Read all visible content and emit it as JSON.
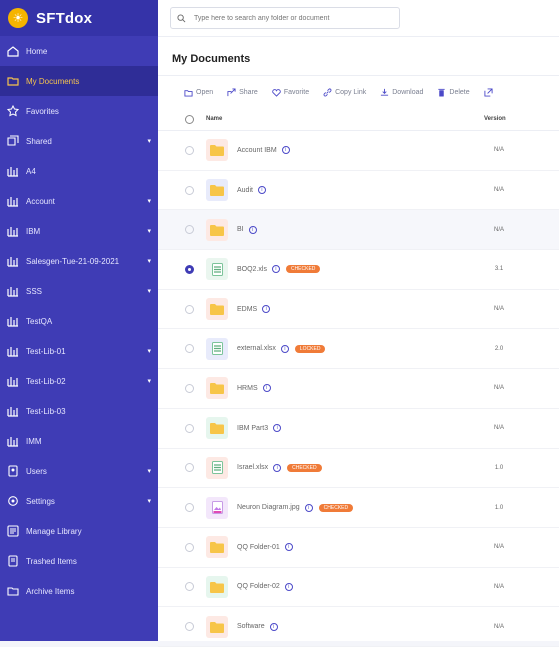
{
  "app": {
    "name": "SFTdox"
  },
  "search": {
    "placeholder": "Type here to search any folder or document"
  },
  "sidebar": {
    "items": [
      {
        "label": "Home",
        "icon": "home-icon",
        "caret": false,
        "active": false
      },
      {
        "label": "My Documents",
        "icon": "documents-icon",
        "caret": false,
        "active": true
      },
      {
        "label": "Favorites",
        "icon": "star-icon",
        "caret": false,
        "active": false
      },
      {
        "label": "Shared",
        "icon": "share-icon",
        "caret": true,
        "active": false
      },
      {
        "label": "A4",
        "icon": "library-icon",
        "caret": false,
        "active": false
      },
      {
        "label": "Account",
        "icon": "library-icon",
        "caret": true,
        "active": false
      },
      {
        "label": "IBM",
        "icon": "library-icon",
        "caret": true,
        "active": false
      },
      {
        "label": "Salesgen-Tue-21-09-2021",
        "icon": "library-icon",
        "caret": true,
        "active": false
      },
      {
        "label": "SSS",
        "icon": "library-icon",
        "caret": true,
        "active": false
      },
      {
        "label": "TestQA",
        "icon": "library-icon",
        "caret": false,
        "active": false
      },
      {
        "label": "Test-Lib-01",
        "icon": "library-icon",
        "caret": true,
        "active": false
      },
      {
        "label": "Test-Lib-02",
        "icon": "library-icon",
        "caret": true,
        "active": false
      },
      {
        "label": "Test-Lib-03",
        "icon": "library-icon",
        "caret": false,
        "active": false
      },
      {
        "label": "IMM",
        "icon": "library-icon",
        "caret": false,
        "active": false
      },
      {
        "label": "Users",
        "icon": "users-icon",
        "caret": true,
        "active": false
      },
      {
        "label": "Settings",
        "icon": "gear-icon",
        "caret": true,
        "active": false
      },
      {
        "label": "Manage Library",
        "icon": "manage-library-icon",
        "caret": false,
        "active": false
      },
      {
        "label": "Trashed Items",
        "icon": "trash-icon",
        "caret": false,
        "active": false
      },
      {
        "label": "Archive Items",
        "icon": "archive-icon",
        "caret": false,
        "active": false
      }
    ]
  },
  "main": {
    "title": "My Documents",
    "toolbar": {
      "open": "Open",
      "share": "Share",
      "favorite": "Favorite",
      "copy_link": "Copy Link",
      "download": "Download",
      "delete": "Delete"
    },
    "table": {
      "headers": {
        "name": "Name",
        "version": "Version"
      },
      "rows": [
        {
          "name": "Account IBM",
          "type": "folder",
          "tint": "red",
          "version": "N/A",
          "checked": false,
          "badge": ""
        },
        {
          "name": "Audit",
          "type": "folder",
          "tint": "blue",
          "version": "N/A",
          "checked": false,
          "badge": ""
        },
        {
          "name": "BI",
          "type": "folder",
          "tint": "red",
          "version": "N/A",
          "checked": false,
          "badge": ""
        },
        {
          "name": "BOQ2.xls",
          "type": "file",
          "tint": "green",
          "version": "3.1",
          "checked": true,
          "badge": "CHECKED"
        },
        {
          "name": "EDMS",
          "type": "folder",
          "tint": "red",
          "version": "N/A",
          "checked": false,
          "badge": ""
        },
        {
          "name": "external.xlsx",
          "type": "file",
          "tint": "blue",
          "version": "2.0",
          "checked": false,
          "badge": "LOCKED"
        },
        {
          "name": "HRMS",
          "type": "folder",
          "tint": "red",
          "version": "N/A",
          "checked": false,
          "badge": ""
        },
        {
          "name": "IBM Part3",
          "type": "folder",
          "tint": "green",
          "version": "N/A",
          "checked": false,
          "badge": ""
        },
        {
          "name": "Israel.xlsx",
          "type": "file",
          "tint": "red",
          "version": "1.0",
          "checked": false,
          "badge": "CHECKED"
        },
        {
          "name": "Neuron Diagram.jpg",
          "type": "image",
          "tint": "purple",
          "version": "1.0",
          "checked": false,
          "badge": "CHECKED"
        },
        {
          "name": "QQ Folder-01",
          "type": "folder",
          "tint": "red",
          "version": "N/A",
          "checked": false,
          "badge": ""
        },
        {
          "name": "QQ Folder-02",
          "type": "folder",
          "tint": "green",
          "version": "N/A",
          "checked": false,
          "badge": ""
        },
        {
          "name": "Software",
          "type": "folder",
          "tint": "red",
          "version": "N/A",
          "checked": false,
          "badge": ""
        }
      ]
    }
  },
  "colors": {
    "sidebar_bg": "#3f3cb5",
    "sidebar_active_bg": "#2f2d97",
    "active_text": "#f6c44e",
    "folder_yellow": "#f7c548",
    "badge_orange": "#f07b38",
    "accent": "#4b49c8"
  }
}
